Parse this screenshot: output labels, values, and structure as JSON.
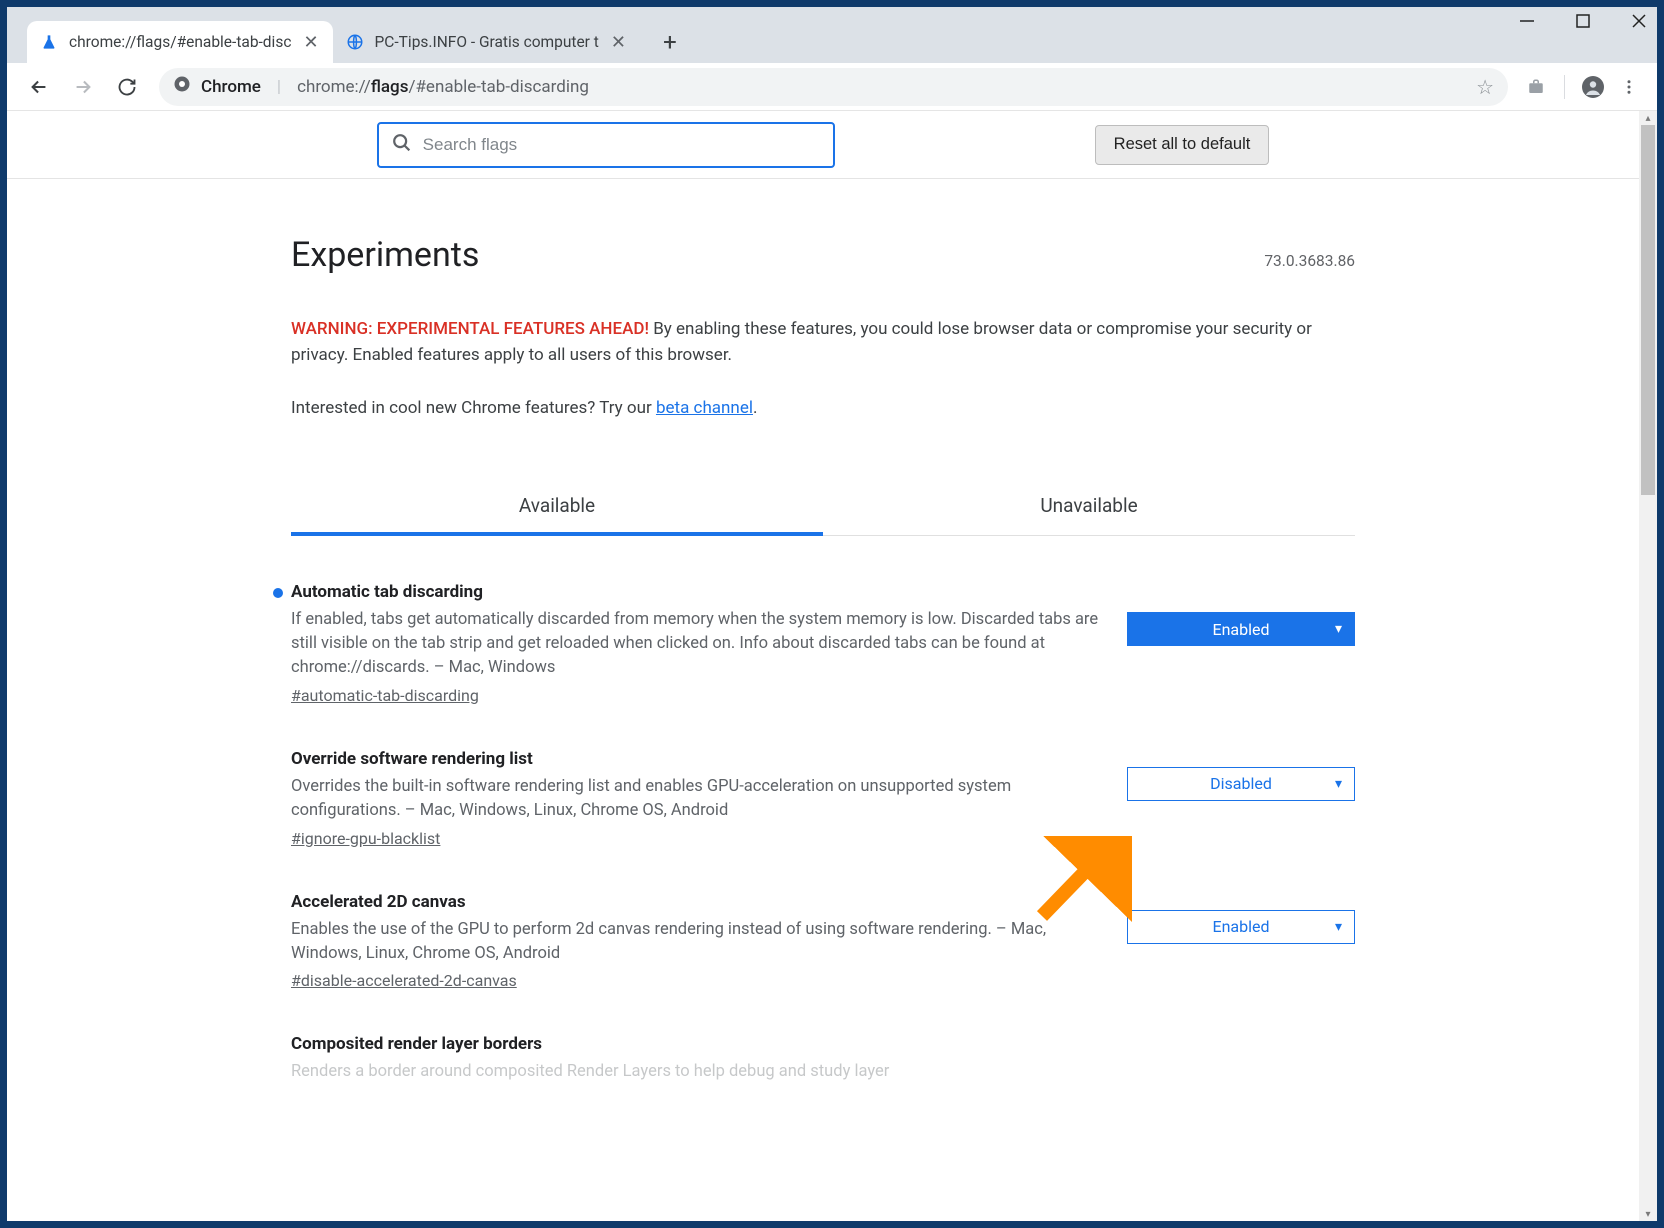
{
  "window": {
    "tabs": [
      {
        "title": "chrome://flags/#enable-tab-disc",
        "active": true,
        "favicon": "flask"
      },
      {
        "title": "PC-Tips.INFO - Gratis computer t",
        "active": false,
        "favicon": "globe"
      }
    ]
  },
  "toolbar": {
    "chrome_label": "Chrome",
    "url_display_before": "chrome://",
    "url_display_bold": "flags",
    "url_display_after": "/#enable-tab-discarding"
  },
  "flags_page": {
    "search_placeholder": "Search flags",
    "reset_button": "Reset all to default",
    "title": "Experiments",
    "version": "73.0.3683.86",
    "warning_label": "WARNING: EXPERIMENTAL FEATURES AHEAD!",
    "warning_text": "By enabling these features, you could lose browser data or compromise your security or privacy. Enabled features apply to all users of this browser.",
    "beta_prefix": "Interested in cool new Chrome features? Try our ",
    "beta_link": "beta channel",
    "tabs": {
      "available": "Available",
      "unavailable": "Unavailable"
    },
    "flags": [
      {
        "title": "Automatic tab discarding",
        "desc": "If enabled, tabs get automatically discarded from memory when the system memory is low. Discarded tabs are still visible on the tab strip and get reloaded when clicked on. Info about discarded tabs can be found at chrome://discards. – Mac, Windows",
        "hash": "#automatic-tab-discarding",
        "value": "Enabled",
        "highlighted": true
      },
      {
        "title": "Override software rendering list",
        "desc": "Overrides the built-in software rendering list and enables GPU-acceleration on unsupported system configurations. – Mac, Windows, Linux, Chrome OS, Android",
        "hash": "#ignore-gpu-blacklist",
        "value": "Disabled",
        "highlighted": false
      },
      {
        "title": "Accelerated 2D canvas",
        "desc": "Enables the use of the GPU to perform 2d canvas rendering instead of using software rendering. – Mac, Windows, Linux, Chrome OS, Android",
        "hash": "#disable-accelerated-2d-canvas",
        "value": "Enabled",
        "highlighted": false
      },
      {
        "title": "Composited render layer borders",
        "desc": "Renders a border around composited Render Layers to help debug and study layer",
        "hash": "",
        "value": "",
        "highlighted": false
      }
    ]
  }
}
